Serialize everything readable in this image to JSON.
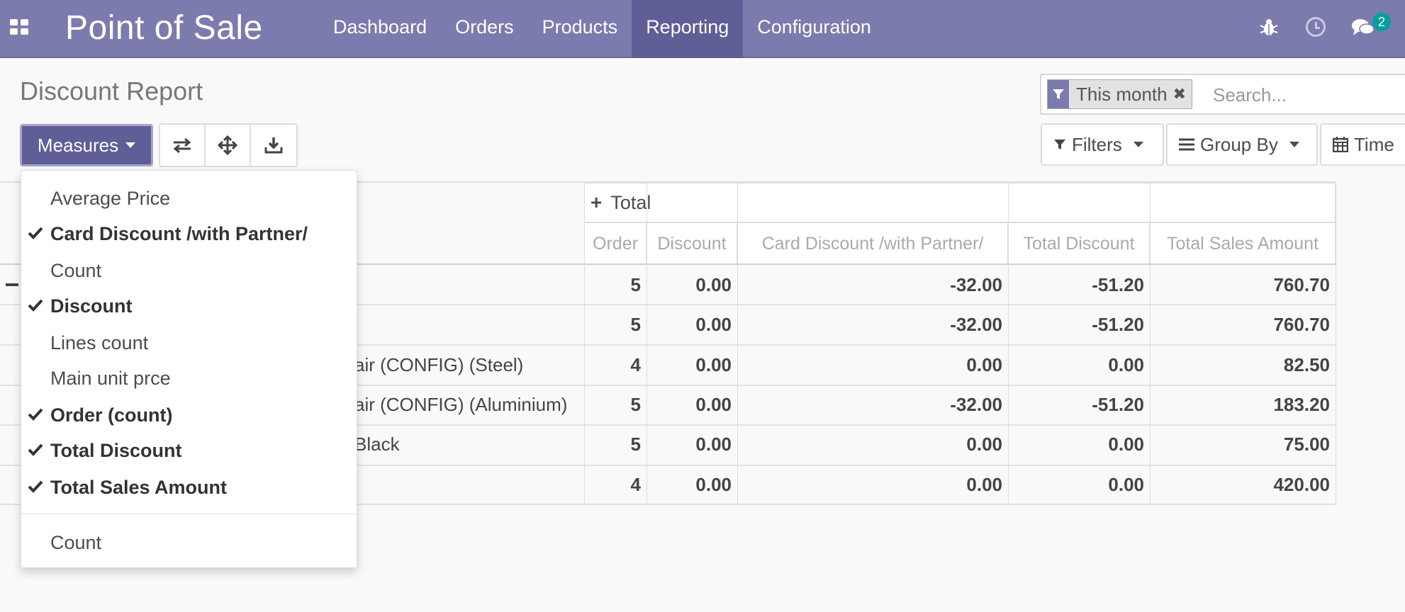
{
  "navbar": {
    "brand": "Point of Sale",
    "menu": [
      {
        "label": "Dashboard"
      },
      {
        "label": "Orders"
      },
      {
        "label": "Products"
      },
      {
        "label": "Reporting",
        "active": true
      },
      {
        "label": "Configuration"
      }
    ],
    "icons": [
      "apps-icon",
      "bug-icon",
      "clock-icon",
      "chat-icon"
    ],
    "chat_badge": "2",
    "colors": {
      "navbar": "#7c7bad",
      "active": "#5f5e97",
      "badge": "#00a09d"
    }
  },
  "control_panel": {
    "title": "Discount Report",
    "measures_label": "Measures",
    "tools": [
      "flip-axis-icon",
      "expand-all-icon",
      "download-icon"
    ],
    "search": {
      "facet": "This month",
      "placeholder": "Search..."
    },
    "filters_label": "Filters",
    "group_by_label": "Group By",
    "time_label": "Time"
  },
  "measures_menu": {
    "items": [
      {
        "label": "Average Price",
        "checked": false
      },
      {
        "label": "Card Discount /with Partner/",
        "checked": true
      },
      {
        "label": "Count",
        "checked": false
      },
      {
        "label": "Discount",
        "checked": true
      },
      {
        "label": "Lines count",
        "checked": false
      },
      {
        "label": "Main unit prce",
        "checked": false
      },
      {
        "label": "Order (count)",
        "checked": true
      },
      {
        "label": "Total Discount",
        "checked": true
      },
      {
        "label": "Total Sales Amount",
        "checked": true
      }
    ],
    "extra": "Count"
  },
  "pivot": {
    "header_total": "Total",
    "columns": [
      "Order",
      "Discount",
      "Card Discount /with Partner/",
      "Total Discount",
      "Total Sales Amount"
    ],
    "rows": [
      {
        "label": "",
        "values": [
          "5",
          "0.00",
          "-32.00",
          "-51.20",
          "760.70"
        ]
      },
      {
        "label": "",
        "values": [
          "5",
          "0.00",
          "-32.00",
          "-51.20",
          "760.70"
        ]
      },
      {
        "label": "air (CONFIG) (Steel)",
        "values": [
          "4",
          "0.00",
          "0.00",
          "0.00",
          "82.50"
        ]
      },
      {
        "label": "air (CONFIG) (Aluminium)",
        "values": [
          "5",
          "0.00",
          "-32.00",
          "-51.20",
          "183.20"
        ]
      },
      {
        "label": "Black",
        "values": [
          "5",
          "0.00",
          "0.00",
          "0.00",
          "75.00"
        ]
      },
      {
        "label": "",
        "values": [
          "4",
          "0.00",
          "0.00",
          "0.00",
          "420.00"
        ]
      }
    ]
  }
}
